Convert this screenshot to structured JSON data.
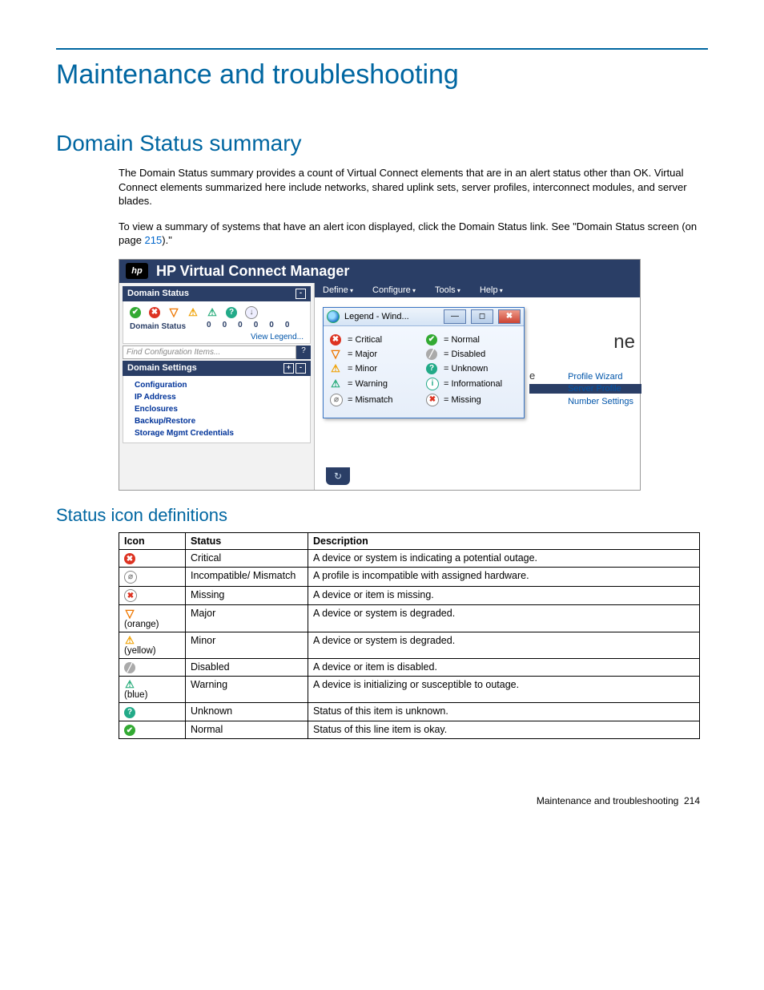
{
  "page": {
    "title_h1": "Maintenance and troubleshooting",
    "title_h2": "Domain Status summary",
    "para1": "The Domain Status summary provides a count of Virtual Connect elements that are in an alert status other than OK. Virtual Connect elements summarized here include networks, shared uplink sets, server profiles, interconnect modules, and server blades.",
    "para2a": "To view a summary of systems that have an alert icon displayed, click the Domain Status link. See \"Domain Status screen (on page ",
    "para2_link": "215",
    "para2b": ").\"",
    "title_h3": "Status icon definitions"
  },
  "figure": {
    "app_title": "HP Virtual Connect Manager",
    "left": {
      "domain_status_hdr": "Domain Status",
      "domain_label": "Domain Status",
      "counts": [
        "0",
        "0",
        "0",
        "0",
        "0",
        "0"
      ],
      "view_legend": "View Legend...",
      "search_placeholder": "Find Configuration Items...",
      "settings_hdr": "Domain Settings",
      "settings_items": [
        "Configuration",
        "IP Address",
        "Enclosures",
        "Backup/Restore",
        "Storage Mgmt Credentials"
      ]
    },
    "menu": [
      "Define",
      "Configure",
      "Tools",
      "Help"
    ],
    "legend": {
      "win_title": "Legend - Wind...",
      "items": [
        {
          "icon": "critical",
          "label": "= Critical"
        },
        {
          "icon": "normal",
          "label": "= Normal"
        },
        {
          "icon": "major",
          "label": "= Major"
        },
        {
          "icon": "disabled",
          "label": "= Disabled"
        },
        {
          "icon": "minor",
          "label": "= Minor"
        },
        {
          "icon": "unknown",
          "label": "= Unknown"
        },
        {
          "icon": "warning",
          "label": "= Warning"
        },
        {
          "icon": "info",
          "label": "= Informational"
        },
        {
          "icon": "mismatch",
          "label": "= Mismatch"
        },
        {
          "icon": "missing",
          "label": "= Missing"
        }
      ]
    },
    "side_links": [
      "Profile Wizard",
      "Server Profile",
      "Number Settings"
    ],
    "ne_frag": "ne",
    "e_frag": "e"
  },
  "table": {
    "headers": [
      "Icon",
      "Status",
      "Description"
    ],
    "rows": [
      {
        "icon": "critical",
        "sub": "",
        "status": "Critical",
        "desc": "A device or system is indicating a potential outage."
      },
      {
        "icon": "mismatch",
        "sub": "",
        "status": "Incompatible/ Mismatch",
        "desc": "A profile is incompatible with assigned hardware."
      },
      {
        "icon": "missing",
        "sub": "",
        "status": "Missing",
        "desc": "A device or item is missing."
      },
      {
        "icon": "major",
        "sub": "(orange)",
        "status": "Major",
        "desc": "A device or system is degraded."
      },
      {
        "icon": "minor",
        "sub": "(yellow)",
        "status": "Minor",
        "desc": "A device or system is degraded."
      },
      {
        "icon": "disabled",
        "sub": "",
        "status": "Disabled",
        "desc": "A device or item is disabled."
      },
      {
        "icon": "warning",
        "sub": "(blue)",
        "status": "Warning",
        "desc": "A device is initializing or susceptible to outage."
      },
      {
        "icon": "unknown",
        "sub": "",
        "status": "Unknown",
        "desc": "Status of this item is unknown."
      },
      {
        "icon": "normal",
        "sub": "",
        "status": "Normal",
        "desc": "Status of this line item is okay."
      }
    ]
  },
  "footer": {
    "text": "Maintenance and troubleshooting",
    "page": "214"
  }
}
